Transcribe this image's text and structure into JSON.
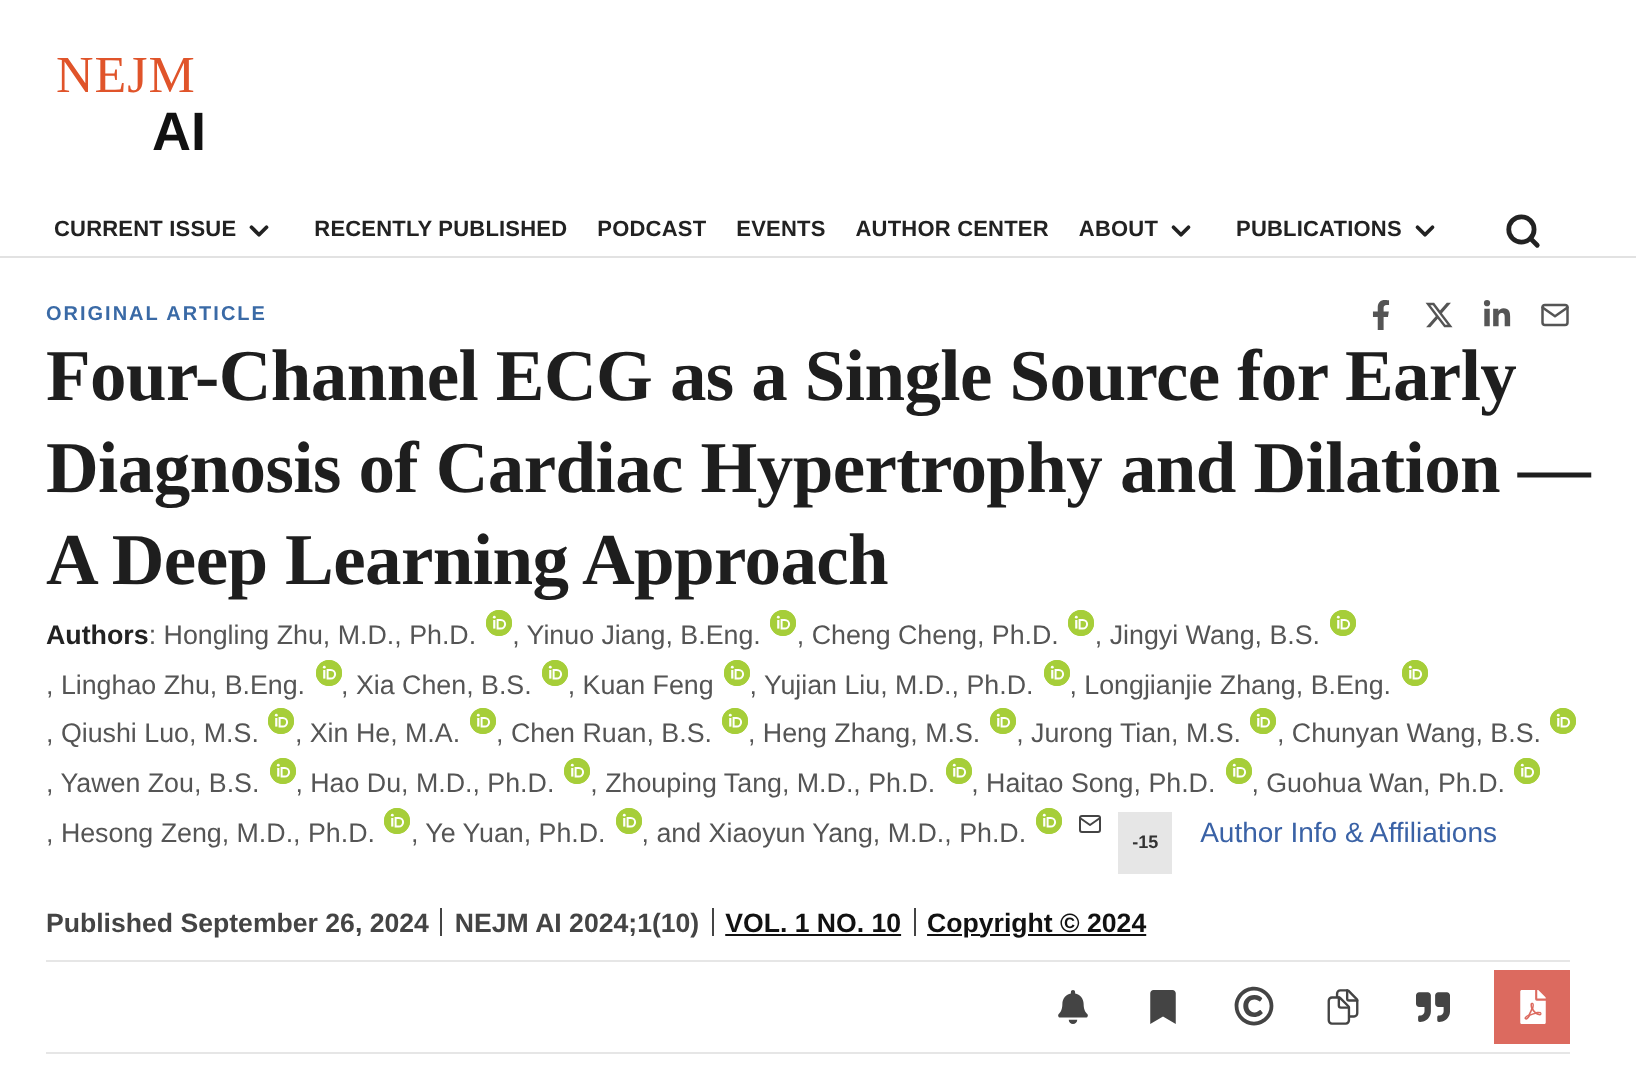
{
  "logo": {
    "top": "NEJM",
    "bottom": "AI"
  },
  "nav": [
    {
      "label": "CURRENT ISSUE",
      "dropdown": true
    },
    {
      "label": "RECENTLY PUBLISHED",
      "dropdown": false
    },
    {
      "label": "PODCAST",
      "dropdown": false
    },
    {
      "label": "EVENTS",
      "dropdown": false
    },
    {
      "label": "AUTHOR CENTER",
      "dropdown": false
    },
    {
      "label": "ABOUT",
      "dropdown": true
    },
    {
      "label": "PUBLICATIONS",
      "dropdown": true
    }
  ],
  "article_type": "ORIGINAL ARTICLE",
  "title": "Four-Channel ECG as a Single Source for Early Diagnosis of Cardiac Hypertrophy and Dilation — A Deep Learning Approach",
  "authors": {
    "label": "Authors",
    "items": [
      {
        "text": ": Hongling Zhu, M.D., Ph.D."
      },
      {
        "text": ", Yinuo Jiang, B.Eng."
      },
      {
        "text": ", Cheng Cheng, Ph.D."
      },
      {
        "text": ", Jingyi Wang, B.S."
      },
      {
        "text": ", Linghao Zhu, B.Eng."
      },
      {
        "text": ", Xia Chen, B.S."
      },
      {
        "text": ", Kuan Feng"
      },
      {
        "text": ", Yujian Liu, M.D., Ph.D."
      },
      {
        "text": ", Longjianjie Zhang, B.Eng."
      },
      {
        "text": ", Qiushi Luo, M.S."
      },
      {
        "text": ", Xin He, M.A."
      },
      {
        "text": ", Chen Ruan, B.S."
      },
      {
        "text": ", Heng Zhang, M.S."
      },
      {
        "text": ", Jurong Tian, M.S."
      },
      {
        "text": ", Chunyan Wang, B.S."
      },
      {
        "text": ", Yawen Zou, B.S."
      },
      {
        "text": ", Hao Du, M.D., Ph.D."
      },
      {
        "text": ", Zhouping Tang, M.D., Ph.D."
      },
      {
        "text": ", Haitao Song, Ph.D."
      },
      {
        "text": ", Guohua Wan, Ph.D."
      },
      {
        "text": ", Hesong Zeng, M.D., Ph.D."
      },
      {
        "text": ", Ye Yuan, Ph.D."
      },
      {
        "text": ", and Xiaoyun Yang, M.D., Ph.D.",
        "contact": true
      }
    ],
    "more_count": "-15",
    "info_link": "Author Info & Affiliations"
  },
  "citation": [
    {
      "text": "Published September 26, 2024",
      "link": false
    },
    {
      "text": "NEJM AI 2024;1(10)",
      "link": false
    },
    {
      "text": "VOL. 1 NO. 10",
      "link": true
    },
    {
      "text": "Copyright © 2024",
      "link": true
    }
  ]
}
